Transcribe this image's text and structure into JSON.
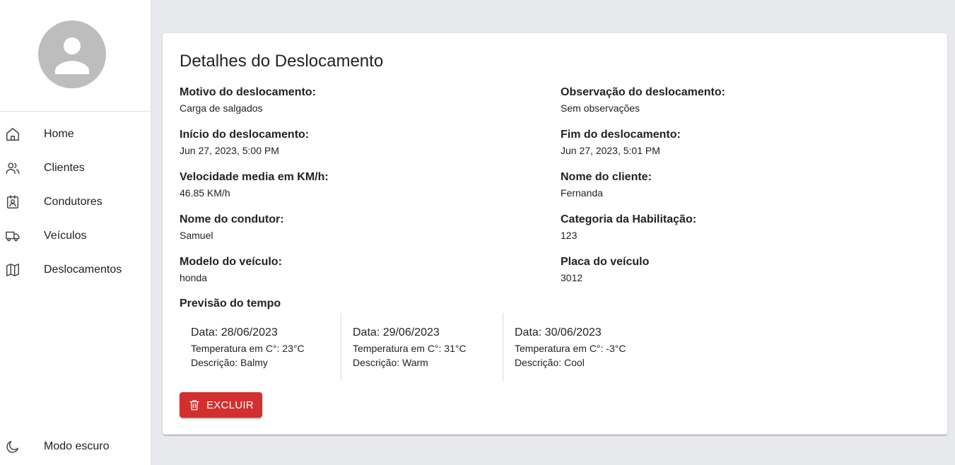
{
  "sidebar": {
    "items": [
      {
        "label": "Home",
        "icon": "home-icon"
      },
      {
        "label": "Clientes",
        "icon": "users-icon"
      },
      {
        "label": "Condutores",
        "icon": "driver-badge-icon"
      },
      {
        "label": "Veículos",
        "icon": "truck-icon"
      },
      {
        "label": "Deslocamentos",
        "icon": "map-icon"
      }
    ],
    "dark_mode_label": "Modo escuro"
  },
  "details": {
    "title": "Detalhes do Deslocamento",
    "fields": [
      {
        "label": "Motivo do deslocamento:",
        "value": "Carga de salgados"
      },
      {
        "label": "Observação do deslocamento:",
        "value": "Sem observações"
      },
      {
        "label": "Início do deslocamento:",
        "value": "Jun 27, 2023, 5:00 PM"
      },
      {
        "label": "Fim do deslocamento:",
        "value": "Jun 27, 2023, 5:01 PM"
      },
      {
        "label": "Velocidade media em KM/h:",
        "value": "46.85 KM/h"
      },
      {
        "label": "Nome do cliente:",
        "value": "Fernanda"
      },
      {
        "label": "Nome do condutor:",
        "value": "Samuel"
      },
      {
        "label": "Categoria da Habilitação:",
        "value": "123"
      },
      {
        "label": "Modelo do veículo:",
        "value": "honda"
      },
      {
        "label": "Placa do veículo",
        "value": "3012"
      }
    ]
  },
  "weather": {
    "title": "Previsão do tempo",
    "days": [
      {
        "date": "Data: 28/06/2023",
        "temperature": "Temperatura em C°: 23°C",
        "description": "Descrição: Balmy"
      },
      {
        "date": "Data: 29/06/2023",
        "temperature": "Temperatura em C°: 31°C",
        "description": "Descrição: Warm"
      },
      {
        "date": "Data: 30/06/2023",
        "temperature": "Temperatura em C°: -3°C",
        "description": "Descrição: Cool"
      }
    ]
  },
  "actions": {
    "delete_label": "EXCLUIR"
  },
  "colors": {
    "danger": "#d32f2f",
    "background": "#e8e9ed",
    "avatar": "#bdbdbd"
  }
}
